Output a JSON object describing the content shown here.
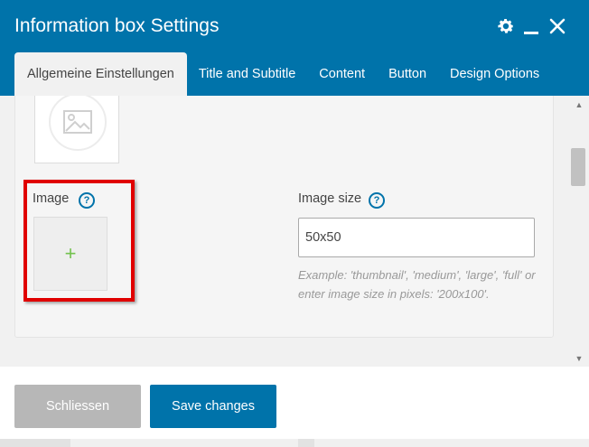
{
  "window": {
    "title": "Information box Settings",
    "header_icons": [
      "gear-icon",
      "minimize-icon",
      "close-icon"
    ]
  },
  "tabs": [
    {
      "label": "Allgemeine Einstellungen",
      "active": true
    },
    {
      "label": "Title and Subtitle",
      "active": false
    },
    {
      "label": "Content",
      "active": false
    },
    {
      "label": "Button",
      "active": false
    },
    {
      "label": "Design Options",
      "active": false
    }
  ],
  "fields": {
    "image": {
      "label": "Image",
      "help": "?",
      "add_symbol": "+"
    },
    "image_size": {
      "label": "Image size",
      "help": "?",
      "value": "50x50",
      "hint": "Example: 'thumbnail', 'medium', 'large', 'full' or enter image size in pixels: '200x100'."
    }
  },
  "footer": {
    "close_label": "Schliessen",
    "save_label": "Save changes"
  },
  "colors": {
    "header": "#0073aa",
    "primary_button": "#0073aa",
    "secondary_button": "#b7b7b7",
    "highlight": "#e00000",
    "add_plus": "#73c24e"
  }
}
